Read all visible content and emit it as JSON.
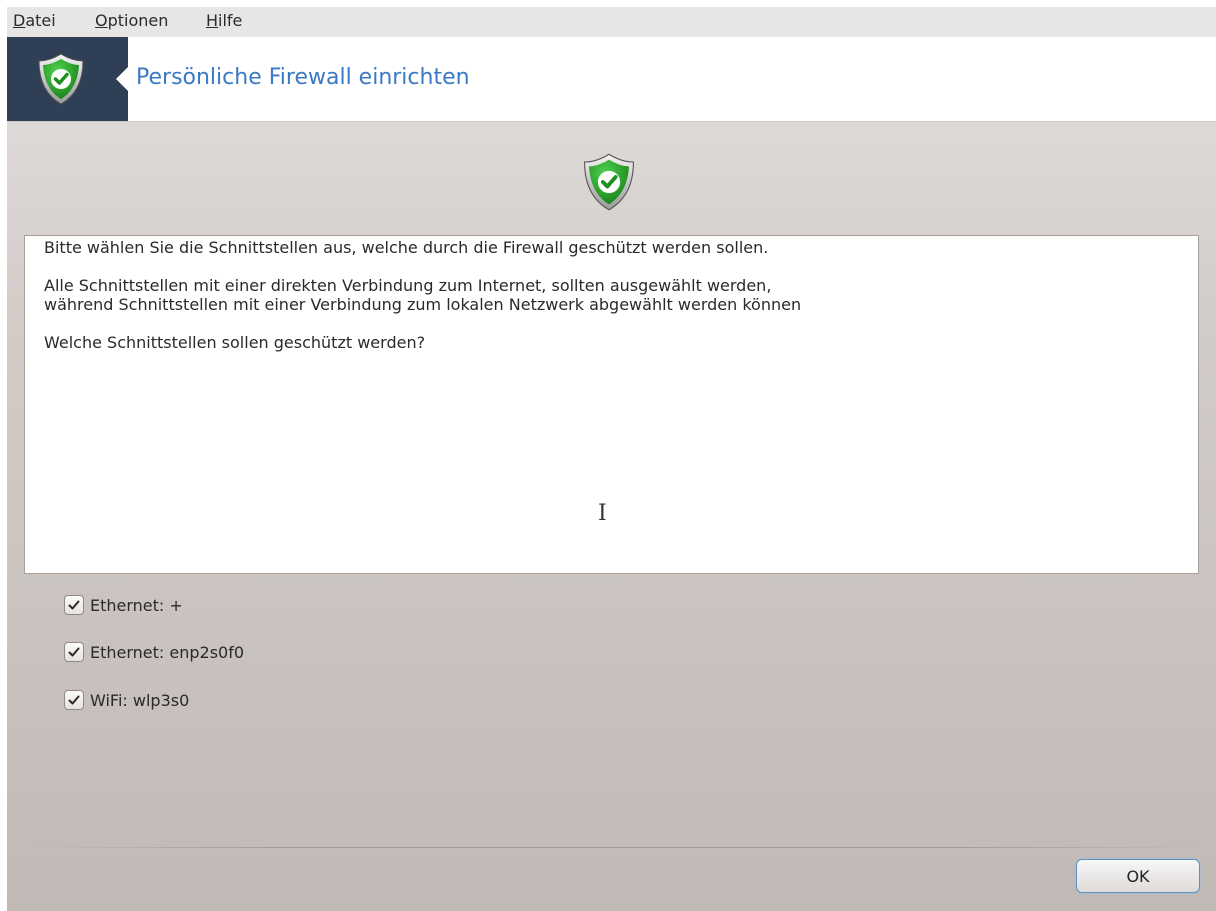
{
  "menubar": {
    "items": [
      {
        "mnemonic": "D",
        "rest": "atei"
      },
      {
        "mnemonic": "O",
        "rest": "ptionen"
      },
      {
        "mnemonic": "H",
        "rest": "ilfe"
      }
    ]
  },
  "banner": {
    "title": "Persönliche Firewall einrichten",
    "icon": "shield-check-icon"
  },
  "content": {
    "icon": "shield-check-icon",
    "paragraphs": [
      "Bitte wählen Sie die Schnittstellen aus, welche durch die Firewall geschützt werden sollen.",
      "Alle Schnittstellen mit einer direkten Verbindung zum Internet, sollten ausgewählt werden,\nwährend Schnittstellen mit einer Verbindung zum lokalen Netzwerk abgewählt werden können",
      "Welche Schnittstellen sollen geschützt werden?"
    ]
  },
  "interfaces": [
    {
      "label": "Ethernet: +",
      "checked": true
    },
    {
      "label": "Ethernet: enp2s0f0",
      "checked": true
    },
    {
      "label": "WiFi: wlp3s0",
      "checked": true
    }
  ],
  "buttons": {
    "ok": "OK"
  },
  "colors": {
    "title_blue": "#3a79c4",
    "shield_green": "#2aa52a",
    "banner_dark": "#2f3f56"
  }
}
